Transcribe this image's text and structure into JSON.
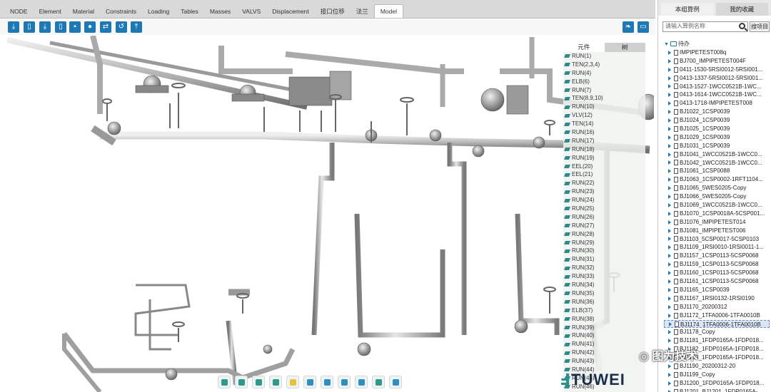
{
  "tabs": [
    "NODE",
    "Element",
    "Material",
    "Constraints",
    "Loading",
    "Tables",
    "Masses",
    "VALVS",
    "Displacement",
    "接口位移",
    "法兰",
    "Model"
  ],
  "active_tab": "Model",
  "toolbar": {
    "icons": [
      "download-icon",
      "file-icon",
      "download-icon",
      "file-icon",
      "save-icon",
      "record-icon",
      "swap-icon",
      "undo-icon",
      "upload-icon"
    ],
    "right_icons": [
      "leaf-icon",
      "window-icon"
    ]
  },
  "element_panel": {
    "tab_component": "元件",
    "tab_tree": "树",
    "items": [
      "RUN(1)",
      "TEN(2,3,4)",
      "RUN(4)",
      "ELB(6)",
      "RUN(7)",
      "TEN(8,9,10)",
      "RUN(10)",
      "VLV(12)",
      "TEN(14)",
      "RUN(16)",
      "RUN(17)",
      "RUN(18)",
      "RUN(19)",
      "EEL(20)",
      "EEL(21)",
      "RUN(22)",
      "RUN(23)",
      "RUN(24)",
      "RUN(25)",
      "RUN(26)",
      "RUN(27)",
      "RUN(28)",
      "RUN(29)",
      "RUN(30)",
      "RUN(31)",
      "RUN(32)",
      "RUN(33)",
      "RUN(34)",
      "RUN(35)",
      "RUN(36)",
      "ELB(37)",
      "RUN(38)",
      "RUN(39)",
      "RUN(40)",
      "RUN(41)",
      "RUN(42)",
      "RUN(43)",
      "RUN(44)",
      "RUN(45)",
      "RUN(46)"
    ]
  },
  "bottom_tools": [
    {
      "name": "view-front-icon",
      "color": "#2f9a8a"
    },
    {
      "name": "view-side-icon",
      "color": "#2f9a8a"
    },
    {
      "name": "view-top-icon",
      "color": "#2f9a8a"
    },
    {
      "name": "view-iso-icon",
      "color": "#2f9a8a"
    },
    {
      "name": "bulb-icon",
      "color": "#e7c23b"
    },
    {
      "name": "fit-icon",
      "color": "#2f8fbf"
    },
    {
      "name": "zoom-box-icon",
      "color": "#2f8fbf"
    },
    {
      "name": "expand-icon",
      "color": "#2f8fbf"
    },
    {
      "name": "tree-link-icon",
      "color": "#2f8fbf"
    },
    {
      "name": "tree-node-icon",
      "color": "#2f9a8a"
    },
    {
      "name": "rotate-icon",
      "color": "#2f8fbf"
    }
  ],
  "sidebar": {
    "tab_group": "本组算例",
    "tab_fav": "我的收藏",
    "search_placeholder": "请输入算例名称",
    "search_button": "搜项目",
    "root_label": "待办",
    "items": [
      "IMPIPETEST008q",
      "BJ700_IMPIPETEST004F",
      "0411-1530-5RSI0012-5RSI001...",
      "0413-1337-5RSI0012-5RSI001...",
      "0413-1527-1WCC0521B-1WC...",
      "0413-1614-1WCC0521B-1WC...",
      "0413-1718-IMPIPETEST008",
      "BJ1022_1CSP0039",
      "BJ1024_1CSP0039",
      "BJ1025_1CSP0039",
      "BJ1029_1CSP0039",
      "BJ1031_1CSP0039",
      "BJ1041_1WCC0521B-1WCC0...",
      "BJ1042_1WCC0521B-1WCC0...",
      "BJ1061_1CSP0088",
      "BJ1063_1CSP0002-1RFT1104...",
      "BJ1065_5WES0205-Copy",
      "BJ1066_5WES0205-Copy",
      "BJ1069_1WCC0521B-1WCC0...",
      "BJ1070_1CSP0018A-5CSP001...",
      "BJ1076_IMPIPETEST014",
      "BJ1081_IMPIPETEST006",
      "BJ1103_5CSP0017-5CSP0103",
      "BJ1109_1RSI0010-1RSI0011-1...",
      "BJ1157_1CSP0113-5CSP0068",
      "BJ1159_1CSP0113-5CSP0068",
      "BJ1160_1CSP0113-5CSP0068",
      "BJ1161_1CSP0113-5CSP0068",
      "BJ1165_1CSP0039",
      "BJ1167_1RSI0132-1RSI0190",
      "BJ1170_20200312",
      "BJ1172_1TFA0006-1TFA0010B",
      "BJ1174_1TFA0006-1TFA0010B",
      "BJ1178_Copy",
      "BJ1181_1FDP0165A-1FDP018...",
      "BJ1182_1FDP0165A-1FDP018...",
      "BJ1183_1FDP0165A-1FDP018...",
      "BJ1190_20200312-20",
      "BJ1199_Copy",
      "BJ1200_1FDP0165A-1FDP018...",
      "BJ1201_BJ1201_1FDP0165A-..."
    ],
    "selected_index": 32
  },
  "watermark": {
    "logo": "TUWEI",
    "wechat": "图为技术"
  }
}
